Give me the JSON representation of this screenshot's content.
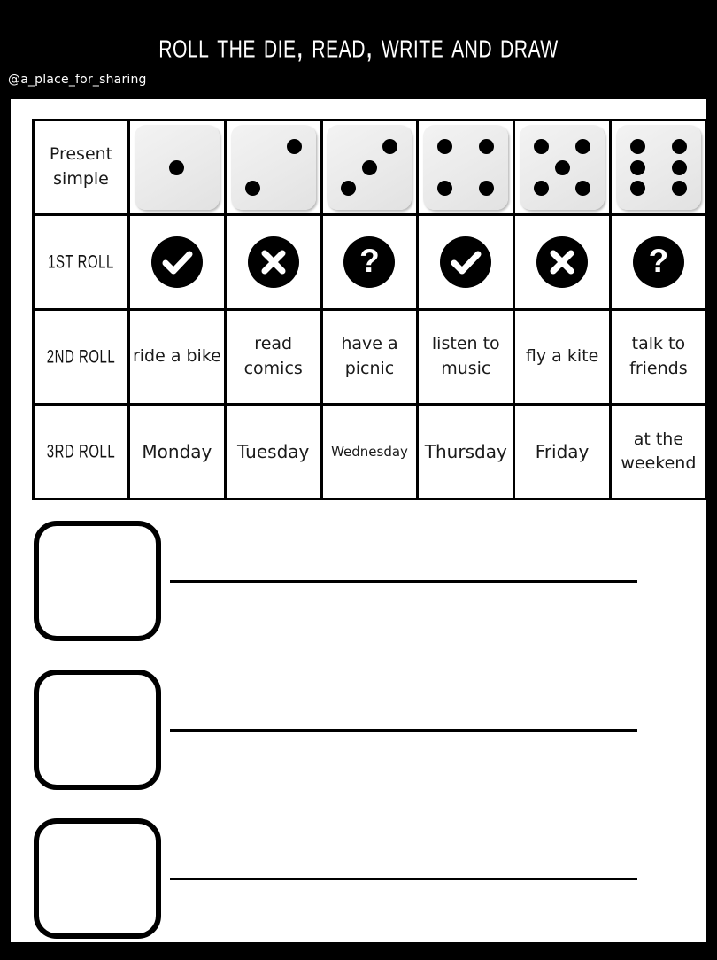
{
  "header": {
    "title": "Roll the die, read, write and draw",
    "handle": "@a_place_for_sharing"
  },
  "table": {
    "row_labels": [
      "Present simple",
      "1ST ROLL",
      "2ND ROLL",
      "3RD ROLL"
    ],
    "dice_row": {
      "label": "Present simple",
      "dice": [
        1,
        2,
        3,
        4,
        5,
        6
      ]
    },
    "first_roll": {
      "label": "1ST ROLL",
      "icons": [
        "check-icon",
        "cross-icon",
        "question-icon",
        "check-icon",
        "cross-icon",
        "question-icon"
      ]
    },
    "second_roll": {
      "label": "2ND ROLL",
      "activities": [
        "ride a bike",
        "read comics",
        "have a picnic",
        "listen to music",
        "fly a kite",
        "talk to friends"
      ]
    },
    "third_roll": {
      "label": "3RD ROLL",
      "days": [
        "Monday",
        "Tuesday",
        "Wednesday",
        "Thursday",
        "Friday",
        "at the weekend"
      ]
    }
  },
  "answers": {
    "rows": [
      {
        "box_label": "",
        "line_label": ""
      },
      {
        "box_label": "",
        "line_label": ""
      },
      {
        "box_label": "",
        "line_label": ""
      }
    ]
  },
  "colors": {
    "page_border": "#000000",
    "sheet": "#ffffff",
    "ink": "#000000",
    "die_face": "#eaeaea"
  }
}
